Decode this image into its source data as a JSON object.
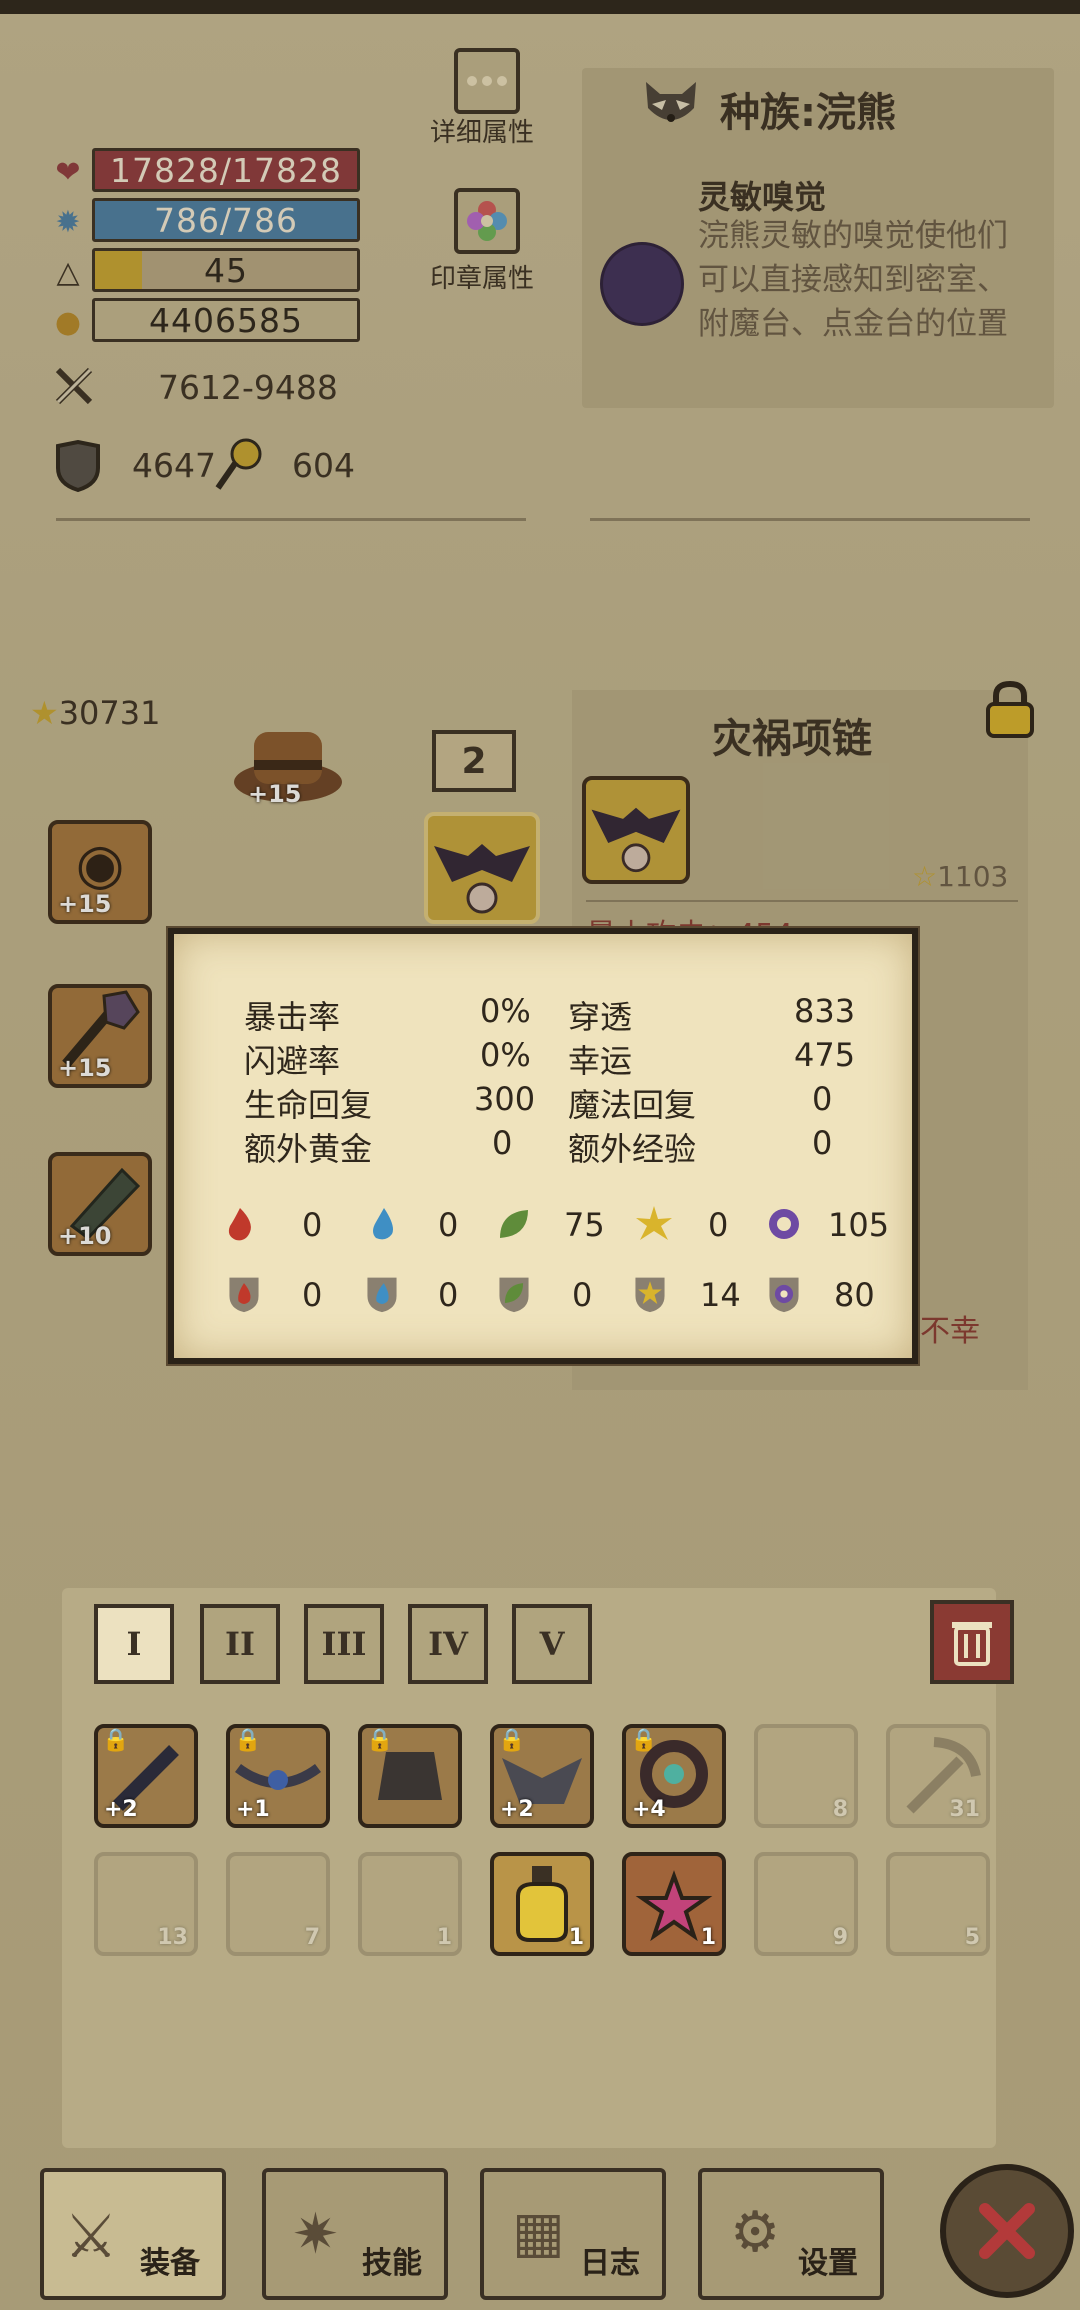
{
  "stats": {
    "hp": "17828/17828",
    "mp": "786/786",
    "level": "45",
    "gold": "4406585",
    "attack": "7612-9488",
    "defense": "4647",
    "magic_defense": "604",
    "level_progress": 0.18
  },
  "buttons": {
    "detail_attrs": "详细属性",
    "seal_attrs": "印章属性"
  },
  "race": {
    "title": "种族:浣熊",
    "skill_name": "灵敏嗅觉",
    "skill_desc": "浣熊灵敏的嗅觉使他们可以直接感知到密室、附魔台、点金台的位置"
  },
  "equipment": {
    "score": "30731",
    "badge": "2",
    "slots": [
      {
        "name": "hat",
        "plus": "+15"
      },
      {
        "name": "helm",
        "plus": "+15"
      },
      {
        "name": "weapon",
        "plus": "+15"
      },
      {
        "name": "gauntlet",
        "plus": "+10"
      }
    ]
  },
  "item_panel": {
    "title": "灾祸项链",
    "score": "1103",
    "attr_partial": "最小攻击：454",
    "bottom_text": "不幸"
  },
  "popup": {
    "stats": [
      {
        "label": "暴击率",
        "value": "0%"
      },
      {
        "label": "穿透",
        "value": "833"
      },
      {
        "label": "闪避率",
        "value": "0%"
      },
      {
        "label": "幸运",
        "value": "475"
      },
      {
        "label": "生命回复",
        "value": "300"
      },
      {
        "label": "魔法回复",
        "value": "0"
      },
      {
        "label": "额外黄金",
        "value": "0"
      },
      {
        "label": "额外经验",
        "value": "0"
      }
    ],
    "attack_elements": [
      "0",
      "0",
      "75",
      "0",
      "105"
    ],
    "defense_elements": [
      "0",
      "0",
      "0",
      "14",
      "80"
    ],
    "colors": {
      "fire": "#c0392b",
      "water": "#3f8fc4",
      "nature": "#5f8c3a",
      "light": "#d9b42c",
      "dark": "#6e4aa3"
    }
  },
  "inventory": {
    "tabs": [
      "I",
      "II",
      "III",
      "IV",
      "V"
    ],
    "row1": [
      {
        "label": "+2",
        "count": ""
      },
      {
        "label": "+1",
        "count": ""
      },
      {
        "label": "",
        "count": ""
      },
      {
        "label": "+2",
        "count": ""
      },
      {
        "label": "+4",
        "count": ""
      },
      {
        "label": "",
        "count": "8"
      },
      {
        "label": "",
        "count": "31"
      }
    ],
    "row2": [
      {
        "count": "13"
      },
      {
        "count": "7"
      },
      {
        "count": "1"
      },
      {
        "count": "1"
      },
      {
        "count": "1"
      },
      {
        "count": "9"
      },
      {
        "count": "5"
      }
    ]
  },
  "nav": {
    "equip": "装备",
    "skills": "技能",
    "log": "日志",
    "settings": "设置"
  }
}
